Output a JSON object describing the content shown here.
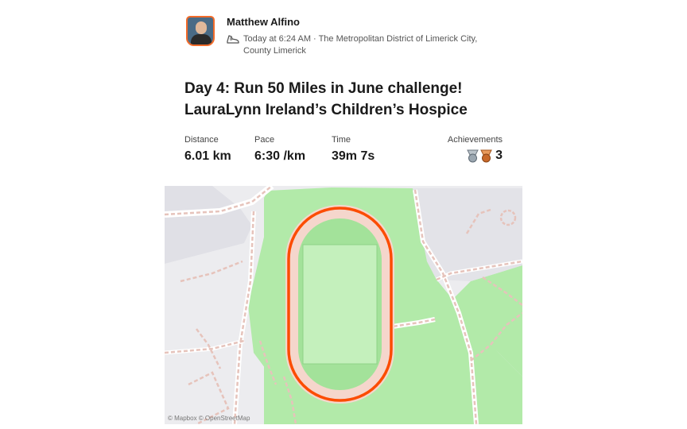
{
  "athlete": {
    "name": "Matthew Alfino",
    "avatar_icon": "avatar",
    "avatar_border_color": "#f26b2a"
  },
  "activity": {
    "sport_icon": "shoe-icon",
    "meta": "Today at 6:24 AM · The Metropolitan District of Limerick City, County Limerick",
    "title": "Day 4: Run 50 Miles in June challenge! LauraLynn Ireland’s Children’s Hospice"
  },
  "stats": {
    "distance": {
      "label": "Distance",
      "value": "6.01 km"
    },
    "pace": {
      "label": "Pace",
      "value": "6:30 /km"
    },
    "time": {
      "label": "Time",
      "value": "39m 7s"
    },
    "achievements": {
      "label": "Achievements",
      "count": "3",
      "icons": [
        "silver-medal-icon",
        "bronze-medal-icon"
      ]
    }
  },
  "map": {
    "route_color": "#fc4c02",
    "park_color": "#a9e6a2",
    "background_color": "#ececef",
    "attribution": "© Mapbox © OpenStreetMap"
  }
}
